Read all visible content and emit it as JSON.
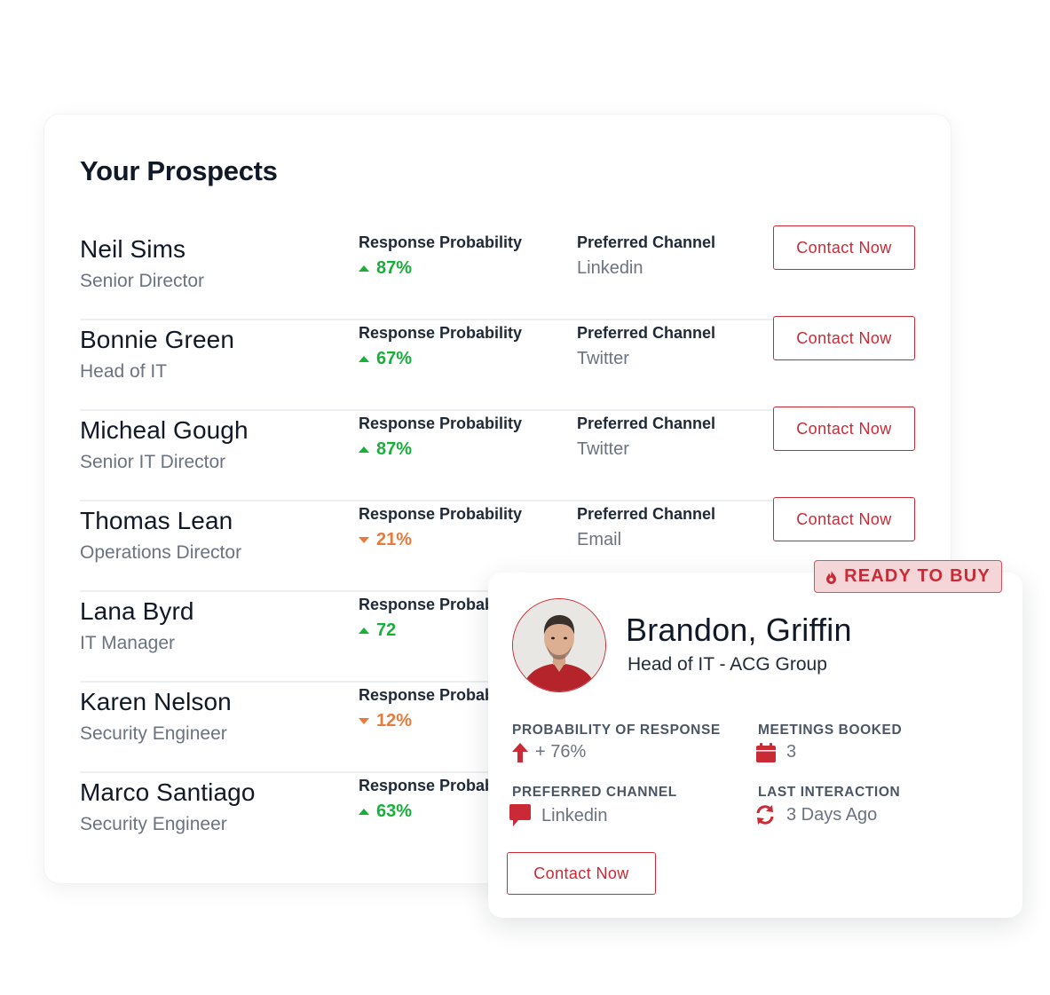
{
  "prospects": {
    "title": "Your Prospects",
    "rows": [
      {
        "name": "Neil Sims",
        "title": "Senior Director",
        "rp_label": "Response Probability",
        "rp_value": "87%",
        "trend": "up",
        "pc_label": "Preferred Channel",
        "pc_value": "Linkedin",
        "button": "Contact Now"
      },
      {
        "name": "Bonnie Green",
        "title": "Head of IT",
        "rp_label": "Response Probability",
        "rp_value": "67%",
        "trend": "up",
        "pc_label": "Preferred Channel",
        "pc_value": "Twitter",
        "button": "Contact Now"
      },
      {
        "name": "Micheal Gough",
        "title": "Senior IT Director",
        "rp_label": "Response Probability",
        "rp_value": "87%",
        "trend": "up",
        "pc_label": "Preferred Channel",
        "pc_value": "Twitter",
        "button": "Contact Now"
      },
      {
        "name": "Thomas Lean",
        "title": "Operations Director",
        "rp_label": "Response Probability",
        "rp_value": "21%",
        "trend": "down",
        "pc_label": "Preferred Channel",
        "pc_value": "Email",
        "button": "Contact Now"
      },
      {
        "name": "Lana Byrd",
        "title": "IT Manager",
        "rp_label": "Response Probab",
        "rp_value": "72",
        "trend": "up"
      },
      {
        "name": "Karen Nelson",
        "title": "Security Engineer",
        "rp_label": "Response Probab",
        "rp_value": "12%",
        "trend": "down"
      },
      {
        "name": "Marco Santiago",
        "title": "Security Engineer",
        "rp_label": "Response Probab",
        "rp_value": "63%",
        "trend": "up"
      }
    ]
  },
  "detail": {
    "badge": "READY TO BUY",
    "badge_icon": "flame-icon",
    "name": "Brandon, Griffin",
    "subtitle": "Head of IT - ACG Group",
    "probability_label": "PROBABILITY OF RESPONSE",
    "probability_value": "+ 76%",
    "meetings_label": "MEETINGS BOOKED",
    "meetings_value": "3",
    "channel_label": "PREFERRED CHANNEL",
    "channel_value": "Linkedin",
    "last_label": "LAST INTERACTION",
    "last_value": "3 Days Ago",
    "button": "Contact Now"
  },
  "colors": {
    "accent": "#c92a35",
    "up": "#16b139",
    "down": "#ea7a3a",
    "badge_bg": "#f5d6d8"
  }
}
